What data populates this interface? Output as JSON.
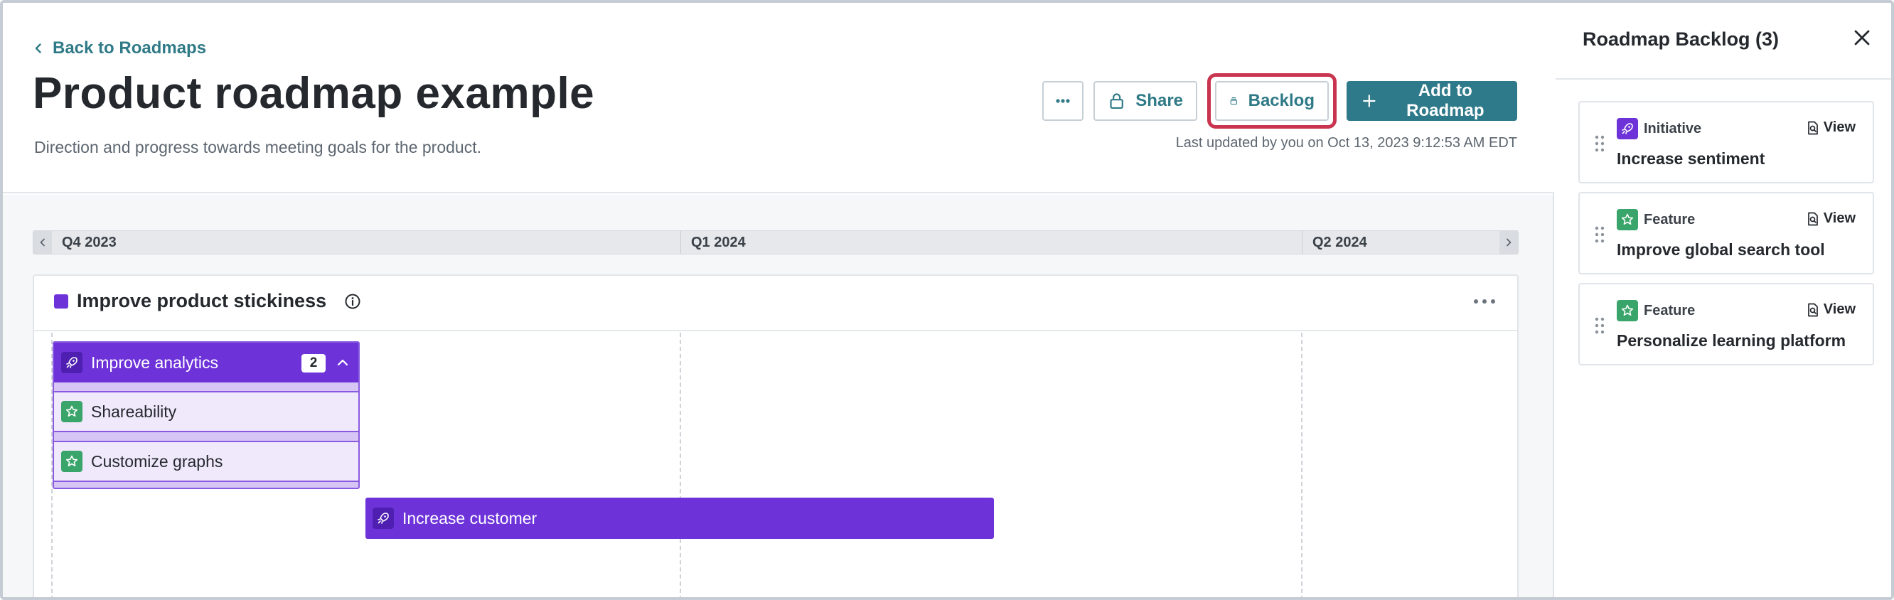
{
  "header": {
    "back_label": "Back to Roadmaps",
    "title": "Product roadmap example",
    "subtitle": "Direction and progress towards meeting goals for the product.",
    "last_updated": "Last updated by you on Oct 13, 2023 9:12:53 AM EDT"
  },
  "toolbar": {
    "share_label": "Share",
    "backlog_label": "Backlog",
    "add_label": "Add to Roadmap"
  },
  "timeline": {
    "quarters": [
      "Q4 2023",
      "Q1 2024",
      "Q2 2024"
    ]
  },
  "goal": {
    "title": "Improve product stickiness",
    "color": "#6d33d9"
  },
  "roadmap_items": {
    "initiative": {
      "label": "Improve analytics",
      "count": "2",
      "children": [
        "Shareability",
        "Customize graphs"
      ]
    },
    "second_initiative": {
      "label": "Increase customer"
    }
  },
  "sidebar": {
    "title": "Roadmap Backlog (3)",
    "view_label": "View",
    "items": [
      {
        "type": "Initiative",
        "title": "Increase sentiment"
      },
      {
        "type": "Feature",
        "title": "Improve global search tool"
      },
      {
        "type": "Feature",
        "title": "Personalize learning platform"
      }
    ]
  },
  "colors": {
    "accent": "#2f7a8a",
    "initiative": "#6d33d9",
    "feature": "#3aa56a",
    "highlight": "#c9344f"
  }
}
